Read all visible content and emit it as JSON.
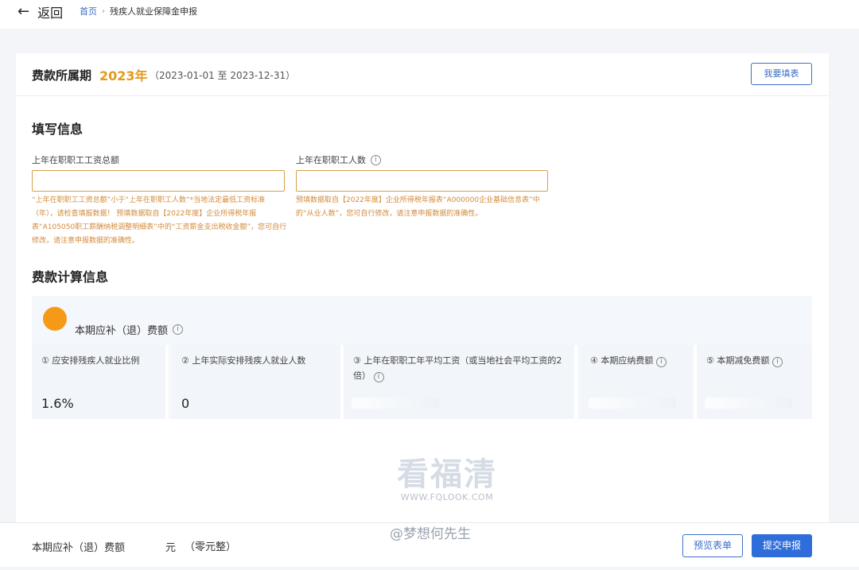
{
  "nav": {
    "back_label": "返回",
    "breadcrumb": {
      "home": "首页",
      "separator": "›",
      "current": "残疾人就业保障金申报"
    }
  },
  "period": {
    "label": "费款所属期",
    "year": "2023年",
    "range": "（2023-01-01 至 2023-12-31）",
    "fill_button": "我要填表"
  },
  "fill_section": {
    "title": "填写信息",
    "total_wage": {
      "label": "上年在职职工工资总额",
      "value": "",
      "hint": "“上年在职职工工资总额”小于“上年在职职工人数”*当地法定最低工资标准（年），请检查填报数据！ 预填数据取自【2022年度】企业所得税年报表“A105050职工薪酬纳税调整明细表”中的“工资薪金支出税收金额”，您可自行修改，请注意申报数据的准确性。"
    },
    "employee_count": {
      "label": "上年在职职工人数",
      "value": "",
      "hint": "预填数据取自【2022年度】企业所得税年报表“A000000企业基础信息表”中的“从业人数”，您可自行修改，请注意申报数据的准确性。"
    }
  },
  "calc_section": {
    "title": "费款计算信息",
    "panel_title": "本期应补（退）费额",
    "metrics": [
      {
        "label": "① 应安排残疾人就业比例",
        "value": "1.6%"
      },
      {
        "label": "② 上年实际安排残疾人就业人数",
        "value": "0"
      },
      {
        "label": "③ 上年在职职工年平均工资（或当地社会平均工资的2倍）",
        "value": ""
      },
      {
        "label": "④ 本期应纳费额",
        "value": ""
      },
      {
        "label": "⑤ 本期减免费额",
        "value": ""
      }
    ]
  },
  "footer": {
    "label": "本期应补（退）费额",
    "unit": "元",
    "amount_words": "（零元整）",
    "preview_button": "预览表单",
    "submit_button": "提交申报"
  },
  "watermark": {
    "brand": "看福清",
    "url": "WWW.FQLOOK.COM",
    "author": "@梦想何先生"
  },
  "colors": {
    "accent_blue": "#3d6fc4",
    "year_orange": "#e39a1c",
    "hint_orange": "#d38a3a",
    "dot_orange": "#f59a16",
    "submit_blue": "#2f6ddb"
  },
  "icons": {
    "back": "arrow-left-icon",
    "info": "info-circle-icon",
    "dot": "orange-dot"
  }
}
